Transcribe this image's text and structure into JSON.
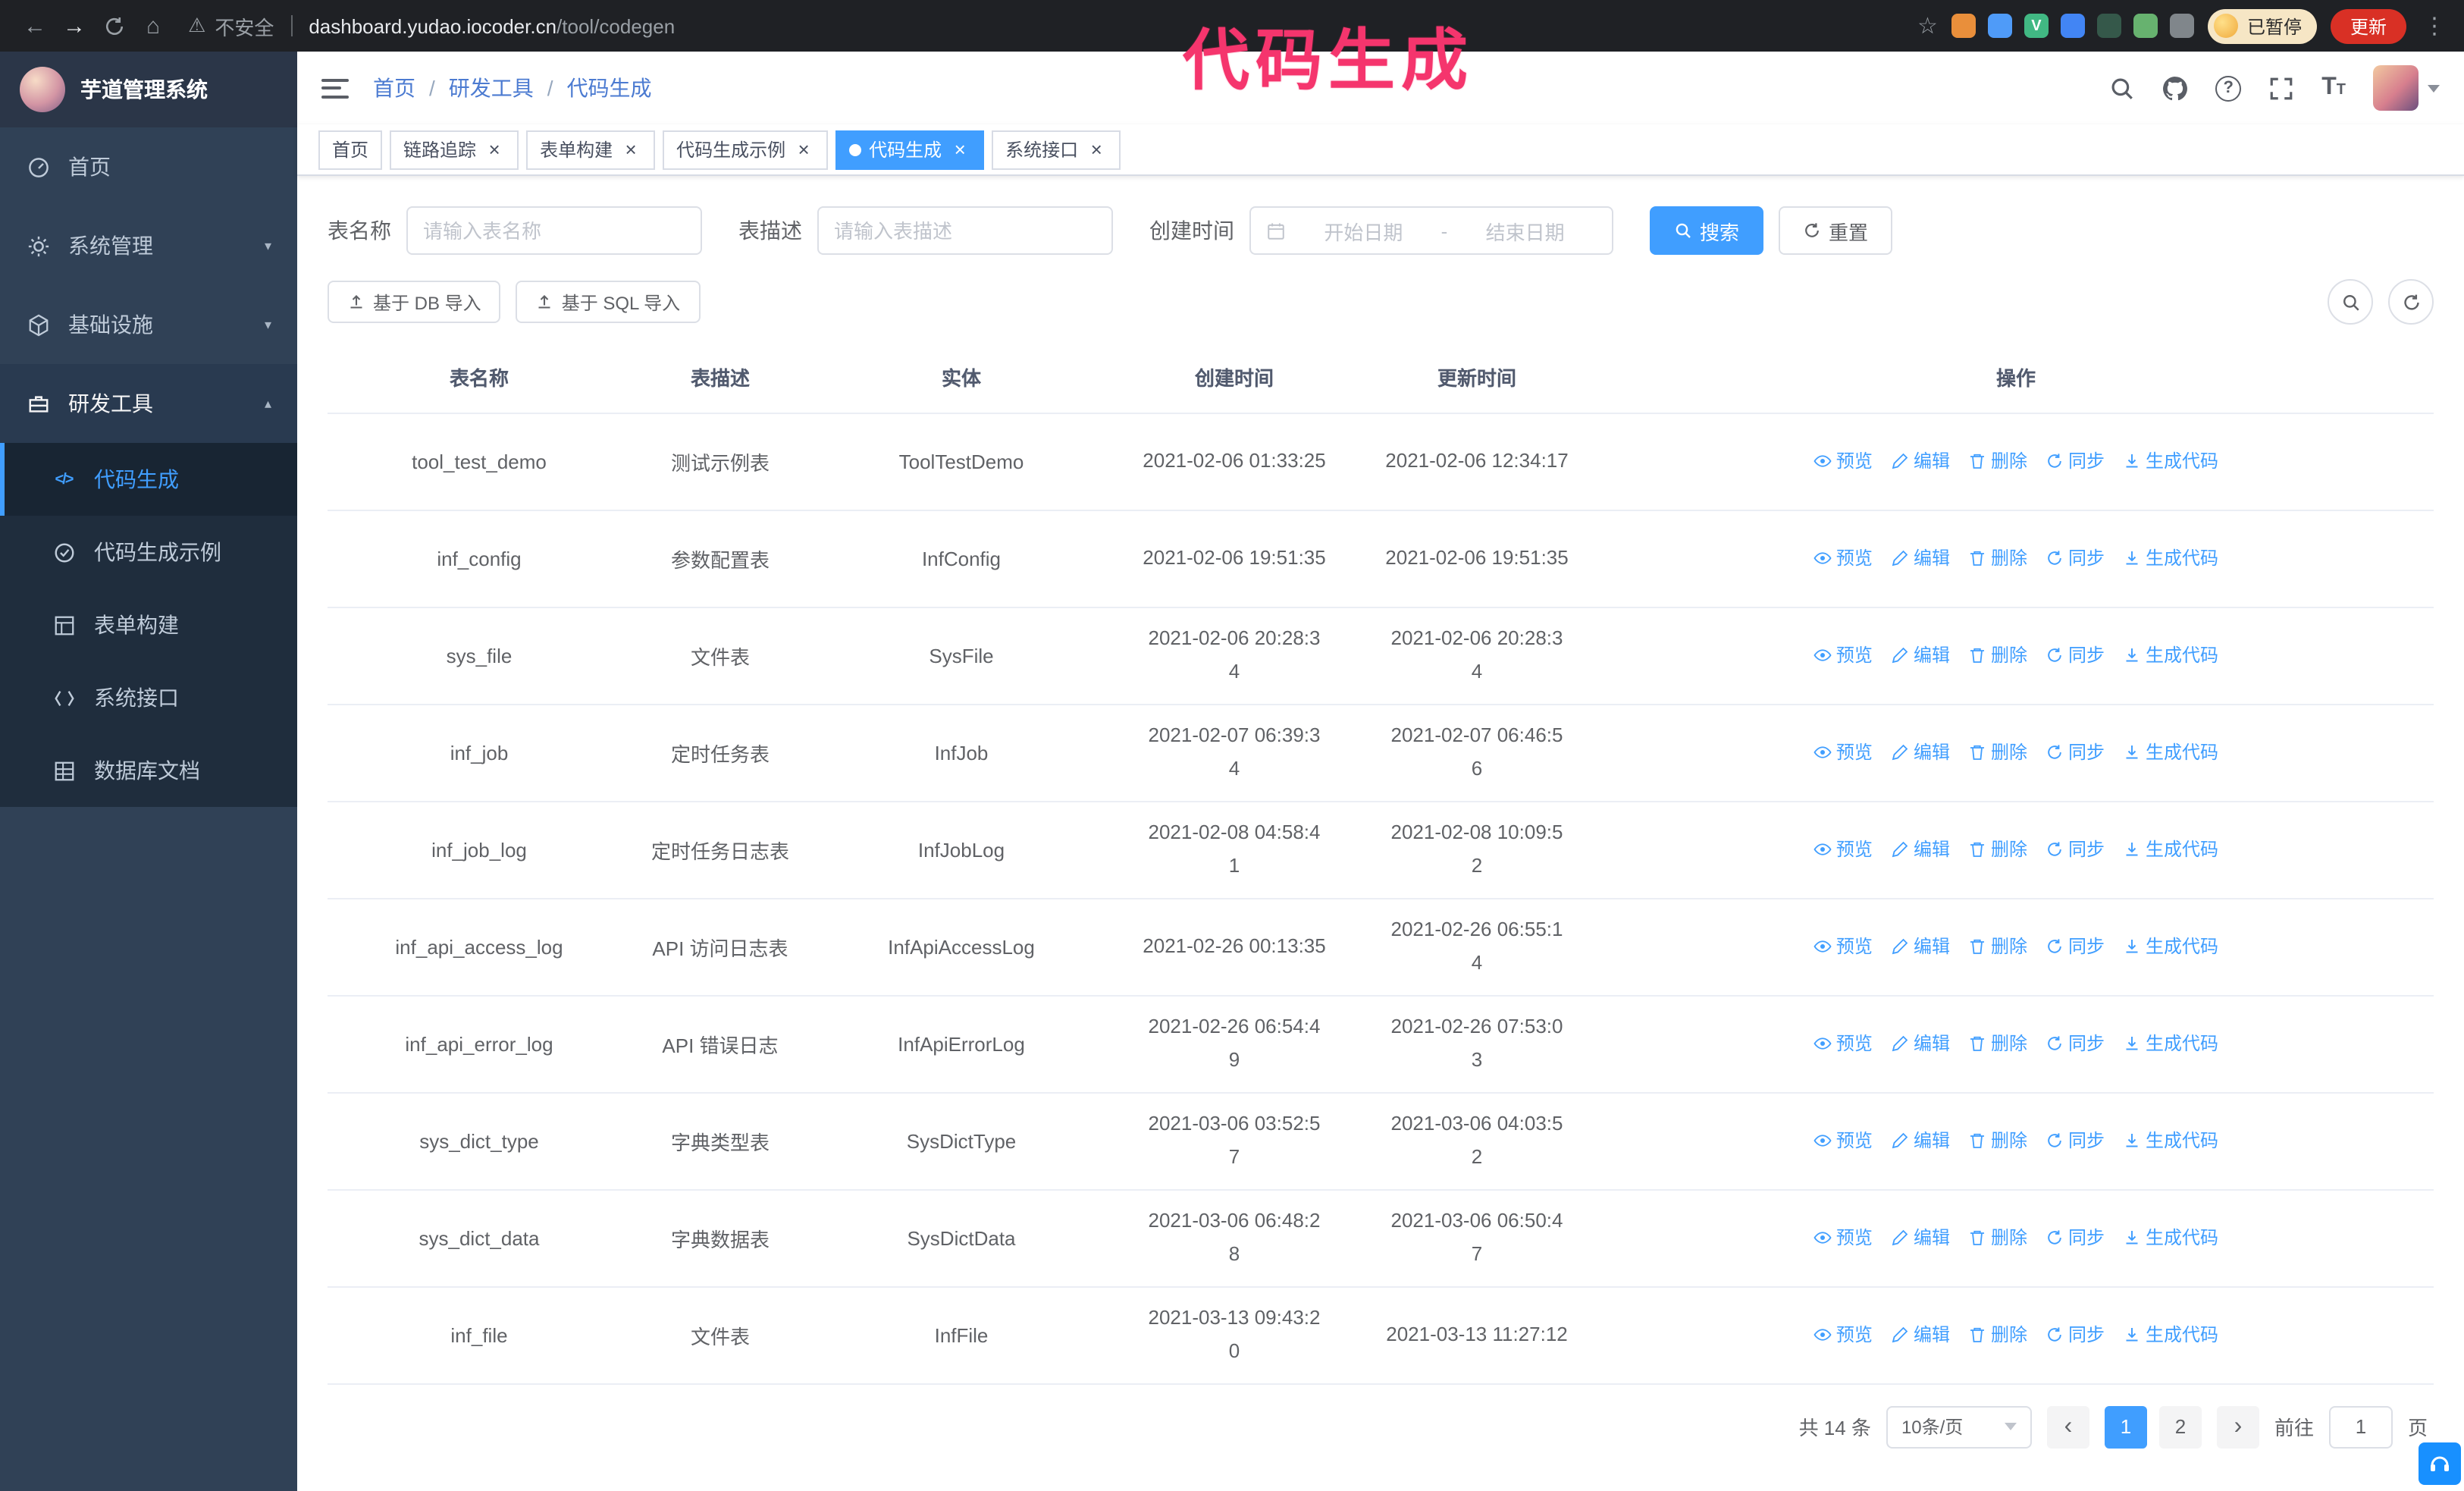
{
  "annotation": {
    "text": "代码生成",
    "color": "#f5356d"
  },
  "colors": {
    "primary": "#409eff",
    "sidebar_bg": "#304156",
    "tab_active": "#409eff"
  },
  "browser": {
    "security_label": "不安全",
    "url_host": "dashboard.yudao.iocoder.cn",
    "url_path": "/tool/codegen",
    "paused_badge": "已暂停",
    "update_button": "更新",
    "extension_icon_colors": [
      "#e98f3b",
      "#4f9bf8",
      "#41b883",
      "#4285f4",
      "#35584a",
      "#67b26f",
      "#80868b"
    ]
  },
  "sidebar": {
    "logo_title": "芋道管理系统",
    "items": [
      {
        "key": "home",
        "label": "首页",
        "icon": "dashboard"
      },
      {
        "key": "system-management",
        "label": "系统管理",
        "icon": "gear",
        "expandable": true
      },
      {
        "key": "infrastructure",
        "label": "基础设施",
        "icon": "infra",
        "expandable": true
      },
      {
        "key": "dev-tools",
        "label": "研发工具",
        "icon": "tools",
        "expandable": true,
        "expanded": true,
        "children": [
          {
            "key": "codegen",
            "label": "代码生成",
            "icon": "code",
            "active": true
          },
          {
            "key": "codegen-example",
            "label": "代码生成示例",
            "icon": "example"
          },
          {
            "key": "form-builder",
            "label": "表单构建",
            "icon": "form"
          },
          {
            "key": "system-api",
            "label": "系统接口",
            "icon": "api"
          },
          {
            "key": "db-doc",
            "label": "数据库文档",
            "icon": "db-doc"
          }
        ]
      }
    ]
  },
  "header": {
    "breadcrumb": [
      "首页",
      "研发工具",
      "代码生成"
    ]
  },
  "tabs": [
    {
      "label": "首页",
      "closable": false
    },
    {
      "label": "链路追踪",
      "closable": true
    },
    {
      "label": "表单构建",
      "closable": true
    },
    {
      "label": "代码生成示例",
      "closable": true
    },
    {
      "label": "代码生成",
      "closable": true,
      "active": true
    },
    {
      "label": "系统接口",
      "closable": true
    }
  ],
  "filters": {
    "table_name_label": "表名称",
    "table_name_placeholder": "请输入表名称",
    "table_desc_label": "表描述",
    "table_desc_placeholder": "请输入表描述",
    "create_time_label": "创建时间",
    "start_date_placeholder": "开始日期",
    "range_separator": "-",
    "end_date_placeholder": "结束日期",
    "search_button": "搜索",
    "reset_button": "重置"
  },
  "toolbar": {
    "import_db_button": "基于 DB 导入",
    "import_sql_button": "基于 SQL 导入"
  },
  "table": {
    "columns": [
      "表名称",
      "表描述",
      "实体",
      "创建时间",
      "更新时间",
      "操作"
    ],
    "row_actions": [
      "预览",
      "编辑",
      "删除",
      "同步",
      "生成代码"
    ],
    "rows": [
      {
        "name": "tool_test_demo",
        "desc": "测试示例表",
        "entity": "ToolTestDemo",
        "created": "2021-02-06 01:33:25",
        "updated": "2021-02-06 12:34:17"
      },
      {
        "name": "inf_config",
        "desc": "参数配置表",
        "entity": "InfConfig",
        "created": "2021-02-06 19:51:35",
        "updated": "2021-02-06 19:51:35"
      },
      {
        "name": "sys_file",
        "desc": "文件表",
        "entity": "SysFile",
        "created": "2021-02-06 20:28:3\n4",
        "updated": "2021-02-06 20:28:3\n4"
      },
      {
        "name": "inf_job",
        "desc": "定时任务表",
        "entity": "InfJob",
        "created": "2021-02-07 06:39:3\n4",
        "updated": "2021-02-07 06:46:5\n6"
      },
      {
        "name": "inf_job_log",
        "desc": "定时任务日志表",
        "entity": "InfJobLog",
        "created": "2021-02-08 04:58:4\n1",
        "updated": "2021-02-08 10:09:5\n2"
      },
      {
        "name": "inf_api_access_log",
        "desc": "API 访问日志表",
        "entity": "InfApiAccessLog",
        "created": "2021-02-26 00:13:35",
        "updated": "2021-02-26 06:55:1\n4"
      },
      {
        "name": "inf_api_error_log",
        "desc": "API 错误日志",
        "entity": "InfApiErrorLog",
        "created": "2021-02-26 06:54:4\n9",
        "updated": "2021-02-26 07:53:0\n3"
      },
      {
        "name": "sys_dict_type",
        "desc": "字典类型表",
        "entity": "SysDictType",
        "created": "2021-03-06 03:52:5\n7",
        "updated": "2021-03-06 04:03:5\n2"
      },
      {
        "name": "sys_dict_data",
        "desc": "字典数据表",
        "entity": "SysDictData",
        "created": "2021-03-06 06:48:2\n8",
        "updated": "2021-03-06 06:50:4\n7"
      },
      {
        "name": "inf_file",
        "desc": "文件表",
        "entity": "InfFile",
        "created": "2021-03-13 09:43:2\n0",
        "updated": "2021-03-13 11:27:12"
      }
    ]
  },
  "pagination": {
    "total_text": "共 14 条",
    "page_size_text": "10条/页",
    "pages": [
      "1",
      "2"
    ],
    "active_page": "1",
    "goto_label": "前往",
    "goto_value": "1",
    "goto_suffix": "页"
  }
}
